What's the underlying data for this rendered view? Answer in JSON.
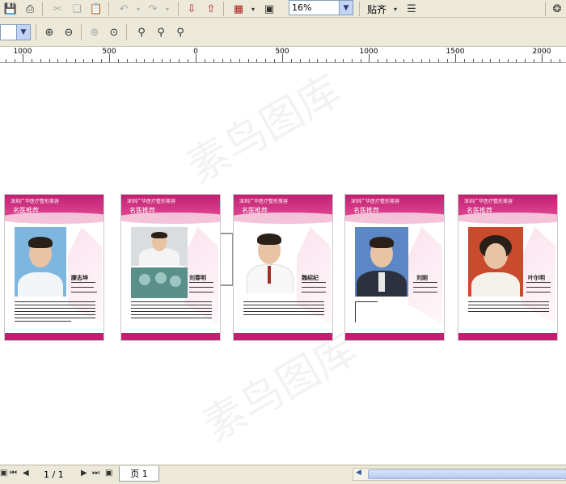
{
  "toolbar": {
    "zoom_value": "16%",
    "snap_label": "贴齐"
  },
  "ruler": {
    "labels": [
      "1000",
      "500",
      "0",
      "500",
      "1000",
      "1500",
      "2000"
    ]
  },
  "cards": [
    {
      "header": "深圳广华医疗整形美容",
      "subtitle": "名医推荐",
      "name": "滕志坤"
    },
    {
      "header": "深圳广华医疗整形美容",
      "subtitle": "名医推荐",
      "name": "刘春明"
    },
    {
      "header": "深圳广华医疗整形美容",
      "subtitle": "名医推荐",
      "name": "魏绍纪"
    },
    {
      "header": "深圳广华医疗整形美容",
      "subtitle": "名医推荐",
      "name": "刘刚"
    },
    {
      "header": "深圳广华医疗整形美容",
      "subtitle": "名医推荐",
      "name": "叶尔明"
    }
  ],
  "watermark": "素鸟图库",
  "status": {
    "page_count": "1 / 1",
    "page_tab": "页 1"
  },
  "colors": {
    "accent": "#c21f73",
    "toolbar_bg": "#ece9d8"
  }
}
